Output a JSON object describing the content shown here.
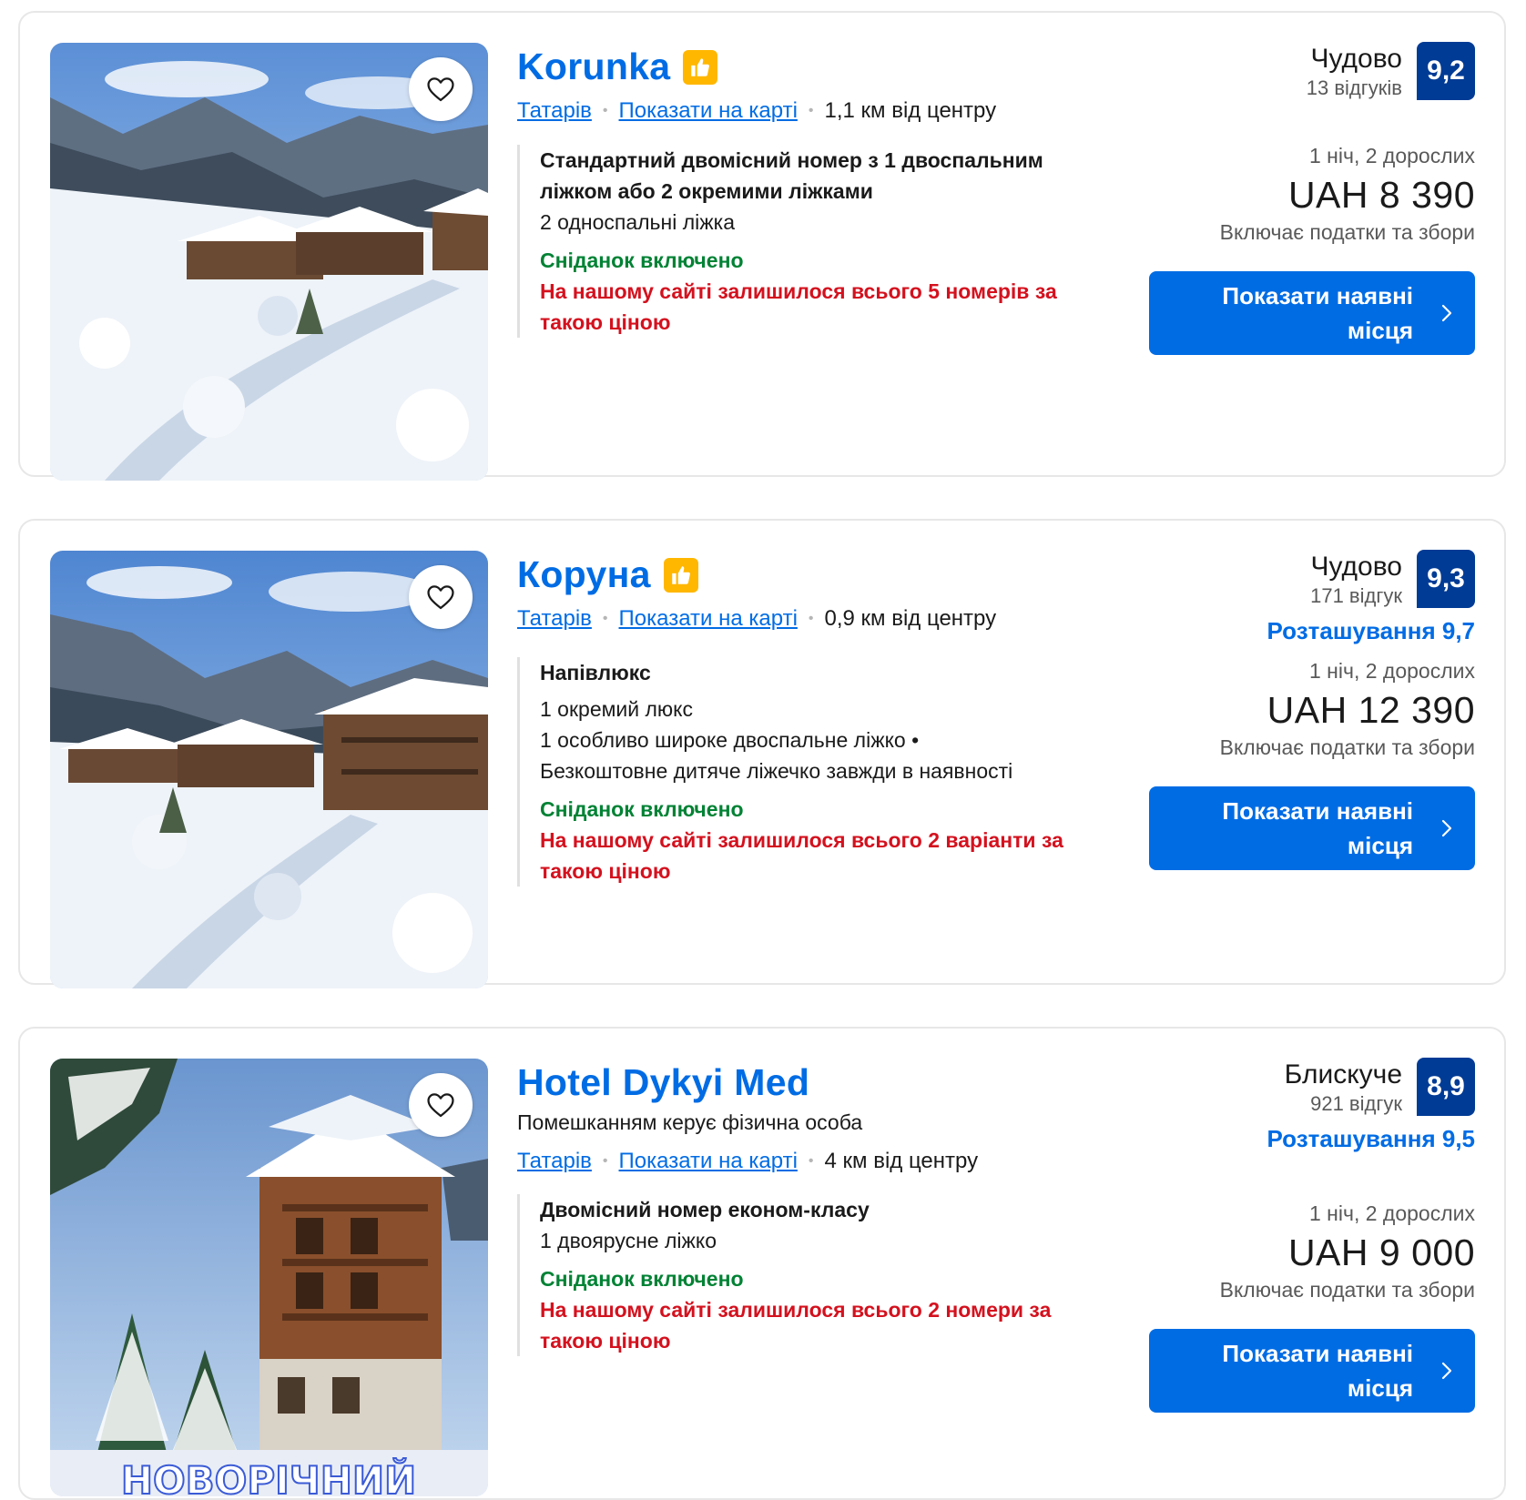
{
  "listings": [
    {
      "name": "Korunka",
      "subtitle": "",
      "location_link": "Татарів",
      "map_link": "Показати на карті",
      "distance": "1,1 км від центру",
      "room_name": "Стандартний двомісний номер з 1 двоспальним ліжком або 2 окремими ліжками",
      "room_details": [
        "2 односпальні ліжка"
      ],
      "breakfast": "Сніданок включено",
      "scarcity": "На нашому сайті залишилося всього 5 номерів за такою ціною",
      "rating_word": "Чудово",
      "review_count": "13 відгуків",
      "score": "9,2",
      "location_score": "",
      "nights_guests": "1 ніч, 2 дорослих",
      "price": "UAH 8 390",
      "taxes": "Включає податки та збори",
      "cta_label": "Показати наявні місця"
    },
    {
      "name": "Коруна",
      "subtitle": "",
      "location_link": "Татарів",
      "map_link": "Показати на карті",
      "distance": "0,9 км від центру",
      "room_name": "Напівлюкс",
      "room_details": [
        "1 окремий люкс",
        "1 особливо широке двоспальне ліжко •",
        "Безкоштовне дитяче ліжечко завжди в наявності"
      ],
      "breakfast": "Сніданок включено",
      "scarcity": "На нашому сайті залишилося всього 2 варіанти за такою ціною",
      "rating_word": "Чудово",
      "review_count": "171 відгук",
      "score": "9,3",
      "location_score": "Розташування 9,7",
      "nights_guests": "1 ніч, 2 дорослих",
      "price": "UAH 12 390",
      "taxes": "Включає податки та збори",
      "cta_label": "Показати наявні місця"
    },
    {
      "name": "Hotel Dykyi Med",
      "subtitle": "Помешканням керує фізична особа",
      "location_link": "Татарів",
      "map_link": "Показати на карті",
      "distance": "4 км від центру",
      "room_name": "Двомісний номер економ-класу",
      "room_details": [
        "1 двоярусне ліжко"
      ],
      "breakfast": "Сніданок включено",
      "scarcity": "На нашому сайті залишилося всього 2 номери за такою ціною",
      "rating_word": "Блискуче",
      "review_count": "921 відгук",
      "score": "8,9",
      "location_score": "Розташування 9,5",
      "nights_guests": "1 ніч, 2 дорослих",
      "price": "UAH 9 000",
      "taxes": "Включає податки та збори",
      "cta_label": "Показати наявні місця",
      "photo_overlay_text": "НОВОРІЧНИЙ"
    }
  ],
  "colors": {
    "link_blue": "#006ce4",
    "score_bg": "#003b95",
    "breakfast_green": "#008234",
    "scarcity_red": "#d4111e",
    "thumb_yellow": "#ffb700"
  },
  "icons": {
    "favorite": "heart-outline-icon",
    "preferred_partner": "thumbs-up-icon",
    "cta_arrow": "chevron-right-icon"
  }
}
